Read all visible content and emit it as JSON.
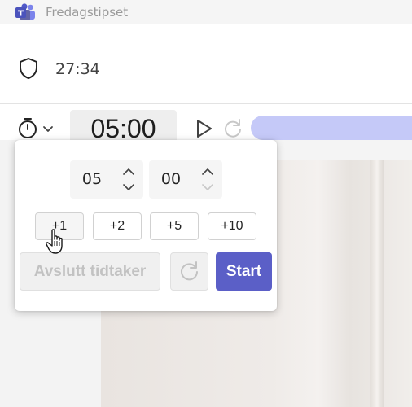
{
  "titlebar": {
    "app_icon": "teams-logo-icon",
    "title": "Fredagstipset"
  },
  "meeting": {
    "icon": "shield-icon",
    "duration": "27:34"
  },
  "toolbar": {
    "timer_icon": "stopwatch-icon",
    "dropdown_icon": "chevron-down-icon",
    "time_display": "05:00",
    "play_icon": "play-icon",
    "reset_icon": "refresh-icon",
    "progress_color": "#c5c9f8"
  },
  "timer_popup": {
    "minutes": {
      "value": "05",
      "up_icon": "chevron-up-icon",
      "down_icon": "chevron-down-icon"
    },
    "seconds": {
      "value": "00",
      "up_icon": "chevron-up-icon",
      "down_icon": "chevron-down-icon"
    },
    "increments": [
      "+1",
      "+2",
      "+5",
      "+10"
    ],
    "end_button": "Avslutt tidtaker",
    "reset_icon": "refresh-icon",
    "start_button": "Start",
    "accent_color": "#5b5fc7"
  },
  "cursor": "hand-pointer-icon"
}
